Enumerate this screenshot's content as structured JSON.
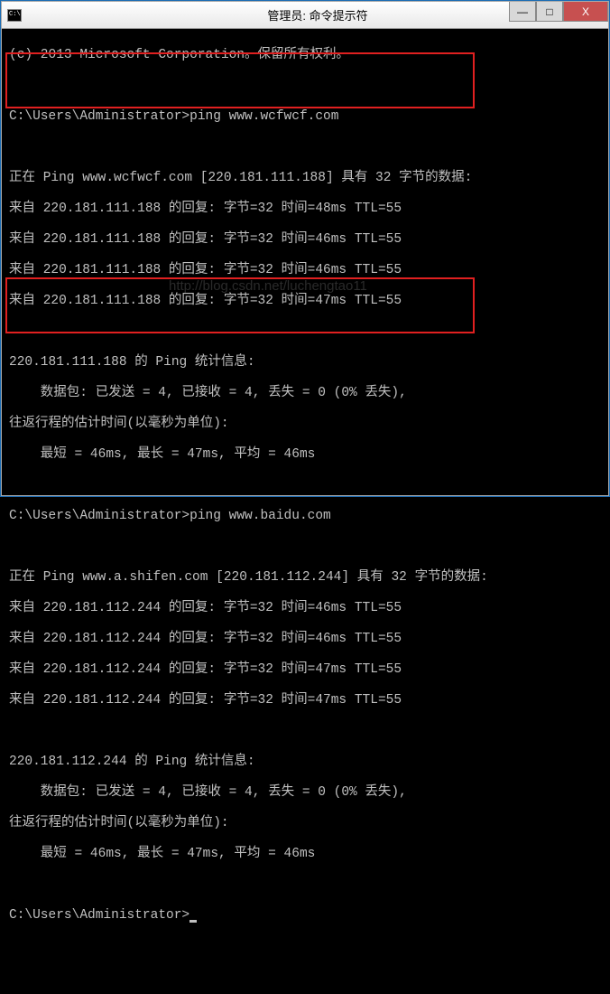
{
  "window": {
    "title": "管理员: 命令提示符"
  },
  "terminal": {
    "lines": [
      "(c) 2013 Microsoft Corporation。保留所有权利。",
      "",
      "C:\\Users\\Administrator>ping www.wcfwcf.com",
      "",
      "正在 Ping www.wcfwcf.com [220.181.111.188] 具有 32 字节的数据:",
      "来自 220.181.111.188 的回复: 字节=32 时间=48ms TTL=55",
      "来自 220.181.111.188 的回复: 字节=32 时间=46ms TTL=55",
      "来自 220.181.111.188 的回复: 字节=32 时间=46ms TTL=55",
      "来自 220.181.111.188 的回复: 字节=32 时间=47ms TTL=55",
      "",
      "220.181.111.188 的 Ping 统计信息:",
      "    数据包: 已发送 = 4, 已接收 = 4, 丢失 = 0 (0% 丢失),",
      "往返行程的估计时间(以毫秒为单位):",
      "    最短 = 46ms, 最长 = 47ms, 平均 = 46ms",
      "",
      "C:\\Users\\Administrator>ping www.baidu.com",
      "",
      "正在 Ping www.a.shifen.com [220.181.112.244] 具有 32 字节的数据:",
      "来自 220.181.112.244 的回复: 字节=32 时间=46ms TTL=55",
      "来自 220.181.112.244 的回复: 字节=32 时间=46ms TTL=55",
      "来自 220.181.112.244 的回复: 字节=32 时间=47ms TTL=55",
      "来自 220.181.112.244 的回复: 字节=32 时间=47ms TTL=55",
      "",
      "220.181.112.244 的 Ping 统计信息:",
      "    数据包: 已发送 = 4, 已接收 = 4, 丢失 = 0 (0% 丢失),",
      "往返行程的估计时间(以毫秒为单位):",
      "    最短 = 46ms, 最长 = 47ms, 平均 = 46ms",
      "",
      "C:\\Users\\Administrator>"
    ],
    "prompt_final": "C:\\Users\\Administrator>"
  },
  "watermark": "http://blog.csdn.net/luchengtao11",
  "controls": {
    "minimize": "—",
    "maximize": "□",
    "close": "X"
  }
}
